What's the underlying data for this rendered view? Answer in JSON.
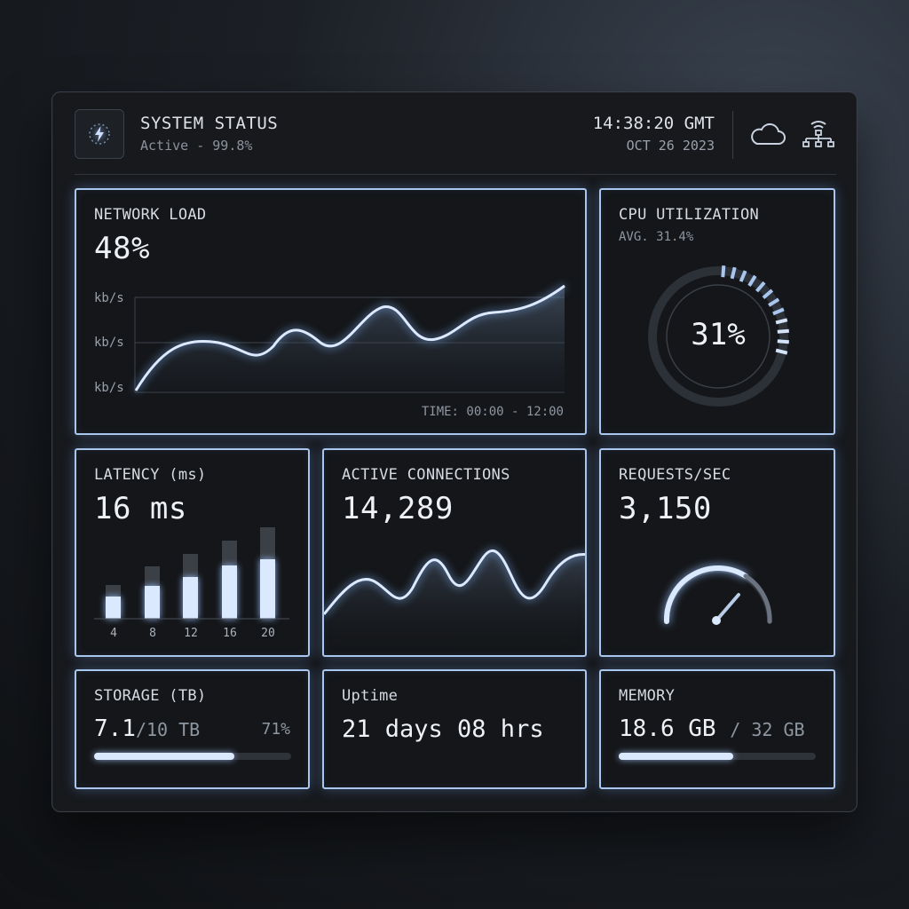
{
  "header": {
    "title": "SYSTEM STATUS",
    "subtitle": "Active - 99.8%",
    "time": "14:38:20 GMT",
    "date": "OCT 26 2023",
    "icons": [
      "bolt-icon",
      "cloud-icon",
      "network-icon"
    ]
  },
  "network_load": {
    "label": "NETWORK LOAD",
    "value": "48%",
    "axis_labels": [
      "kb/s",
      "kb/s",
      "kb/s"
    ],
    "time_range": "TIME: 00:00 - 12:00"
  },
  "cpu": {
    "label": "CPU UTILIZATION",
    "avg": "AVG. 31.4%",
    "value": "31%",
    "fraction": 0.31
  },
  "latency": {
    "label": "LATENCY (ms)",
    "value": "16 ms",
    "categories": [
      "4",
      "8",
      "12",
      "16",
      "20"
    ]
  },
  "connections": {
    "label": "ACTIVE CONNECTIONS",
    "value": "14,289"
  },
  "requests": {
    "label": "REQUESTS/SEC",
    "value": "3,150"
  },
  "storage": {
    "label": "STORAGE (TB)",
    "used": "7.1",
    "total": "/10 TB",
    "percent": "71%",
    "fraction": 0.71
  },
  "uptime": {
    "label": "Uptime",
    "value": "21 days 08 hrs"
  },
  "memory": {
    "label": "MEMORY",
    "used": "18.6 GB",
    "total": "/ 32 GB",
    "fraction": 0.58
  },
  "colors": {
    "accent": "#a9c6ee",
    "glow": "#dbe9ff",
    "background": "#17191d"
  }
}
